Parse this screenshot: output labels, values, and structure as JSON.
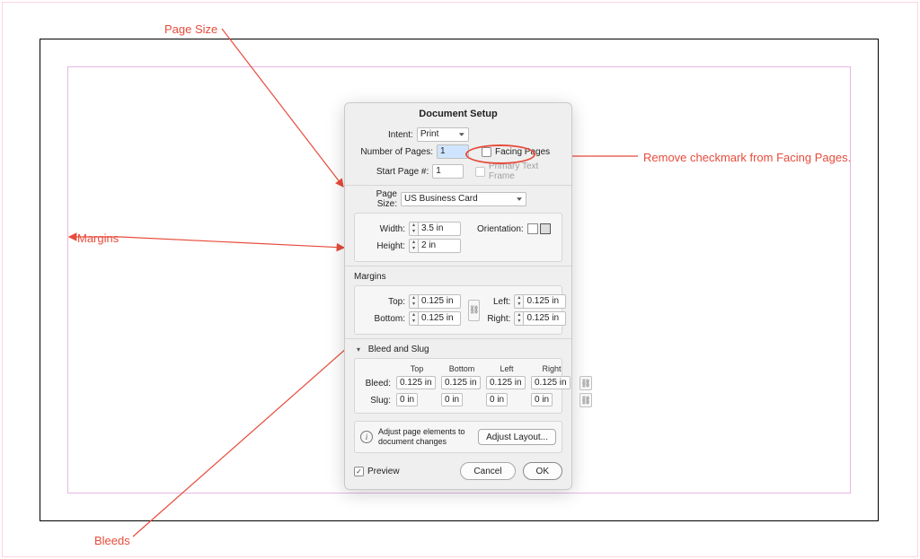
{
  "annotations": {
    "page_size": "Page Size",
    "margins": "Margins",
    "bleeds": "Bleeds",
    "remove_facing": "Remove checkmark from Facing Pages."
  },
  "dialog": {
    "title": "Document Setup",
    "intent_label": "Intent:",
    "intent_value": "Print",
    "num_pages_label": "Number of Pages:",
    "num_pages_value": "1",
    "start_page_label": "Start Page #:",
    "start_page_value": "1",
    "facing_pages": "Facing Pages",
    "primary_text_frame": "Primary Text Frame",
    "page_size_label": "Page Size:",
    "page_size_value": "US Business Card",
    "width_label": "Width:",
    "width_value": "3.5 in",
    "height_label": "Height:",
    "height_value": "2 in",
    "orientation_label": "Orientation:",
    "margins_label": "Margins",
    "margin_top_label": "Top:",
    "margin_top_value": "0.125 in",
    "margin_bottom_label": "Bottom:",
    "margin_bottom_value": "0.125 in",
    "margin_left_label": "Left:",
    "margin_left_value": "0.125 in",
    "margin_right_label": "Right:",
    "margin_right_value": "0.125 in",
    "bleed_slug_label": "Bleed and Slug",
    "col_top": "Top",
    "col_bottom": "Bottom",
    "col_left": "Left",
    "col_right": "Right",
    "bleed_label": "Bleed:",
    "bleed_top": "0.125 in",
    "bleed_bottom": "0.125 in",
    "bleed_left": "0.125 in",
    "bleed_right": "0.125 in",
    "slug_label": "Slug:",
    "slug_top": "0 in",
    "slug_bottom": "0 in",
    "slug_left": "0 in",
    "slug_right": "0 in",
    "adjust_text": "Adjust page elements to document changes",
    "adjust_btn": "Adjust Layout...",
    "preview_label": "Preview",
    "cancel": "Cancel",
    "ok": "OK"
  }
}
